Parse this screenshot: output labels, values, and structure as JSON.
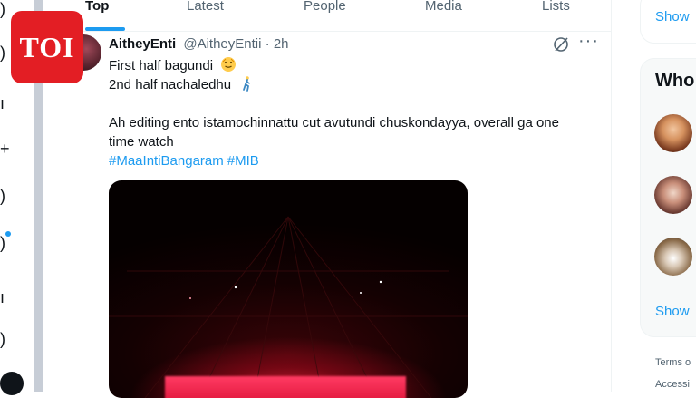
{
  "tabs": [
    {
      "label": "Top",
      "active": true
    },
    {
      "label": "Latest",
      "active": false
    },
    {
      "label": "People",
      "active": false
    },
    {
      "label": "Media",
      "active": false
    },
    {
      "label": "Lists",
      "active": false
    }
  ],
  "logo": {
    "text": "TOI",
    "color": "#e31e24"
  },
  "tweet": {
    "name": "AitheyEnti",
    "handle": "@AitheyEntii",
    "separator": "·",
    "time": "2h",
    "lines": [
      "First half bagundi",
      "2nd half nachaledhu",
      "Ah editing ento istamochinnattu cut avutundi chuskondayya, overall ga one",
      "time watch"
    ],
    "hashtags": [
      "#MaaIntiBangaram",
      "#MIB"
    ],
    "emoji_1": "slightly-smiling-face-icon",
    "emoji_2": "walking-person-icon",
    "more_label": "···"
  },
  "sidebar": {
    "show_more_top": "Show",
    "who_to_follow": "Who",
    "show_more_bottom": "Show",
    "terms": "Terms o",
    "accessibility": "Accessi"
  },
  "colors": {
    "accent": "#1d9bf0",
    "text": "#0f1419",
    "muted": "#536471",
    "toi_red": "#e31e24"
  }
}
